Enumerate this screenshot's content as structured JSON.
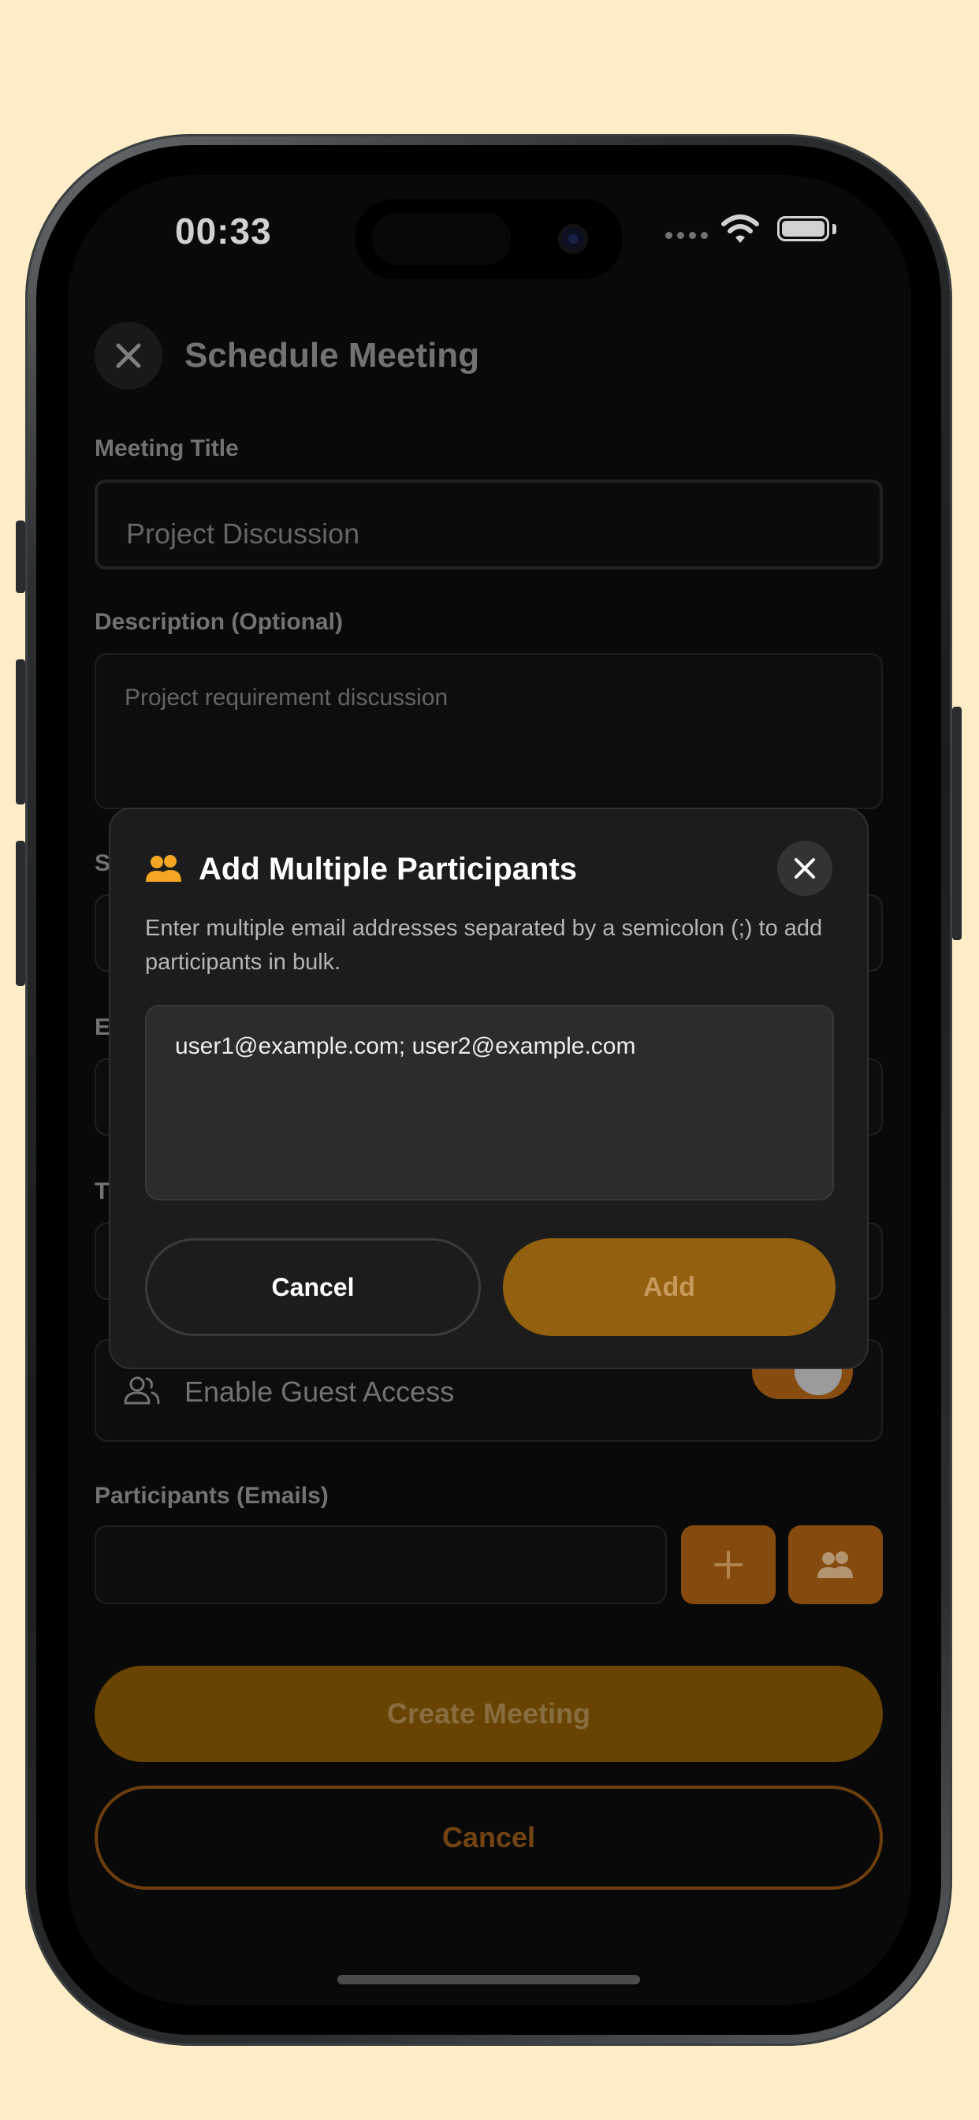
{
  "status_bar": {
    "time": "00:33"
  },
  "header": {
    "title": "Schedule Meeting"
  },
  "form": {
    "meeting_title_label": "Meeting Title",
    "meeting_title_value": "Project Discussion",
    "description_label": "Description (Optional)",
    "description_value": "Project requirement discussion",
    "start_label_partial": "S",
    "end_label_partial": "E",
    "time_label_partial": "T",
    "guest_access_label": "Enable Guest Access",
    "guest_access_enabled": true,
    "participants_label": "Participants (Emails)",
    "participants_value": ""
  },
  "modal": {
    "title": "Add Multiple Participants",
    "description": "Enter multiple email addresses separated by a semicolon (;) to add participants in bulk.",
    "emails_value": "user1@example.com; user2@example.com",
    "cancel_label": "Cancel",
    "add_label": "Add"
  },
  "footer": {
    "create_label": "Create Meeting",
    "cancel_label": "Cancel"
  },
  "colors": {
    "accent": "#F5A623",
    "accent_dim": "#7F5202",
    "background": "#0B0B0B",
    "page_bg": "#FFEDC7"
  },
  "icons": {
    "close": "close-icon",
    "participants": "people-icon",
    "add": "plus-icon",
    "guest": "people-outline-icon",
    "wifi": "wifi-icon",
    "battery": "battery-icon"
  }
}
